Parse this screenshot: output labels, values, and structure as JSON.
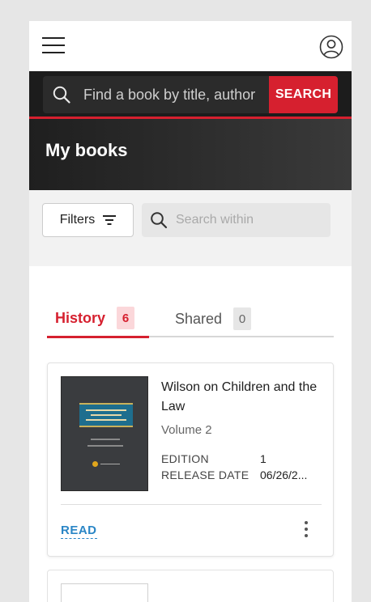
{
  "header": {
    "search_placeholder": "Find a book by title, author",
    "search_button": "SEARCH",
    "menu_icon": "hamburger-menu-icon",
    "user_icon": "user-profile-icon"
  },
  "page": {
    "title": "My books"
  },
  "filters": {
    "filters_label": "Filters",
    "filters_icon": "filter-lines-icon",
    "search_within_placeholder": "Search within"
  },
  "tabs": [
    {
      "label": "History",
      "count": "6",
      "active": true
    },
    {
      "label": "Shared",
      "count": "0",
      "active": false
    }
  ],
  "books": [
    {
      "title": "Wilson on Children and the Law",
      "volume": "Volume 2",
      "edition_label": "EDITION",
      "edition_value": "1",
      "release_label": "RELEASE DATE",
      "release_value": "06/26/2...",
      "read_label": "READ",
      "more_icon": "more-vertical-icon"
    }
  ],
  "colors": {
    "accent": "#d6202f",
    "link": "#2a86c6",
    "dark_band": "#1c1c1c"
  }
}
